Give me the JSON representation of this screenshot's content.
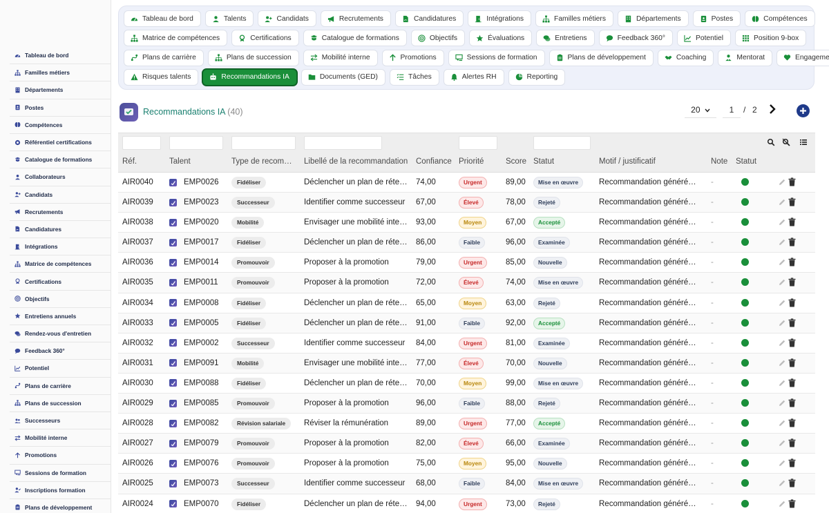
{
  "sidebar": {
    "items": [
      {
        "label": "Tableau de bord",
        "icon": "dashboard-icon"
      },
      {
        "label": "Familles métiers",
        "icon": "sitemap-icon"
      },
      {
        "label": "Départements",
        "icon": "building-icon"
      },
      {
        "label": "Postes",
        "icon": "badge-icon"
      },
      {
        "label": "Compétences",
        "icon": "brain-icon"
      },
      {
        "label": "Référentiel certifications",
        "icon": "certificate-icon"
      },
      {
        "label": "Catalogue de formations",
        "icon": "catalog-icon"
      },
      {
        "label": "Collaborateurs",
        "icon": "user-icon"
      },
      {
        "label": "Candidats",
        "icon": "user-plus-icon"
      },
      {
        "label": "Recrutements",
        "icon": "megaphone-icon"
      },
      {
        "label": "Candidatures",
        "icon": "file-signature-icon"
      },
      {
        "label": "Intégrations",
        "icon": "door-icon"
      },
      {
        "label": "Matrice de compétences",
        "icon": "sitemap-icon"
      },
      {
        "label": "Certifications",
        "icon": "award-icon"
      },
      {
        "label": "Objectifs",
        "icon": "target-icon"
      },
      {
        "label": "Entretiens annuels",
        "icon": "star-icon"
      },
      {
        "label": "Rendez-vous d'entretien",
        "icon": "comments-icon"
      },
      {
        "label": "Feedback 360°",
        "icon": "comment-icon"
      },
      {
        "label": "Potentiel",
        "icon": "chart-line-icon"
      },
      {
        "label": "Plans de carrière",
        "icon": "route-icon"
      },
      {
        "label": "Plans de succession",
        "icon": "sitemap-icon"
      },
      {
        "label": "Successeurs",
        "icon": "users-icon"
      },
      {
        "label": "Mobilité interne",
        "icon": "exchange-icon"
      },
      {
        "label": "Promotions",
        "icon": "arrow-up-icon"
      },
      {
        "label": "Sessions de formation",
        "icon": "chalkboard-icon"
      },
      {
        "label": "Inscriptions formation",
        "icon": "user-check-icon"
      },
      {
        "label": "Plans de développement",
        "icon": "clipboard-icon"
      }
    ]
  },
  "tabs": {
    "rows": [
      [
        {
          "label": "Tableau de bord",
          "icon": "dashboard-icon"
        },
        {
          "label": "Talents",
          "icon": "user-icon"
        },
        {
          "label": "Candidats",
          "icon": "user-plus-icon"
        },
        {
          "label": "Recrutements",
          "icon": "megaphone-icon"
        },
        {
          "label": "Candidatures",
          "icon": "file-signature-icon"
        },
        {
          "label": "Intégrations",
          "icon": "door-icon"
        },
        {
          "label": "Familles métiers",
          "icon": "sitemap-icon"
        },
        {
          "label": "Départements",
          "icon": "building-icon"
        },
        {
          "label": "Postes",
          "icon": "badge-icon"
        },
        {
          "label": "Compétences",
          "icon": "brain-icon"
        }
      ],
      [
        {
          "label": "Matrice de compétences",
          "icon": "sitemap-icon"
        },
        {
          "label": "Certifications",
          "icon": "award-icon"
        },
        {
          "label": "Catalogue de formations",
          "icon": "catalog-icon"
        },
        {
          "label": "Objectifs",
          "icon": "target-icon"
        },
        {
          "label": "Évaluations",
          "icon": "star-icon"
        },
        {
          "label": "Entretiens",
          "icon": "comments-icon"
        },
        {
          "label": "Feedback 360°",
          "icon": "comment-icon"
        },
        {
          "label": "Potentiel",
          "icon": "chart-line-icon"
        },
        {
          "label": "Position 9-box",
          "icon": "grid-icon"
        }
      ],
      [
        {
          "label": "Plans de carrière",
          "icon": "route-icon"
        },
        {
          "label": "Plans de succession",
          "icon": "sitemap-icon"
        },
        {
          "label": "Mobilité interne",
          "icon": "exchange-icon"
        },
        {
          "label": "Promotions",
          "icon": "arrow-up-icon"
        },
        {
          "label": "Sessions de formation",
          "icon": "chalkboard-icon"
        },
        {
          "label": "Plans de développement",
          "icon": "clipboard-icon"
        },
        {
          "label": "Coaching",
          "icon": "handshake-icon"
        },
        {
          "label": "Mentorat",
          "icon": "user-tie-icon"
        },
        {
          "label": "Engagement",
          "icon": "heart-icon"
        }
      ],
      [
        {
          "label": "Risques talents",
          "icon": "warning-icon"
        },
        {
          "label": "Recommandations IA",
          "icon": "robot-icon",
          "active": true
        },
        {
          "label": "Documents (GED)",
          "icon": "folder-icon"
        },
        {
          "label": "Tâches",
          "icon": "tasks-icon"
        },
        {
          "label": "Alertes RH",
          "icon": "bell-icon"
        },
        {
          "label": "Reporting",
          "icon": "pie-chart-icon"
        }
      ]
    ]
  },
  "header": {
    "title": "Recommandations IA",
    "count": "(40)"
  },
  "pager": {
    "page_size": "20",
    "current_page": "1",
    "separator": "/",
    "total_pages": "2"
  },
  "table": {
    "columns": {
      "ref": "Réf.",
      "talent": "Talent",
      "type": "Type de recom…",
      "label": "Libellé de la recommandation",
      "confidence": "Confiance",
      "priority": "Priorité",
      "score": "Score",
      "status": "Statut",
      "motif": "Motif / justificatif",
      "note": "Note",
      "status2": "Statut"
    },
    "rows": [
      {
        "ref": "AIR0040",
        "talent": "EMP0026",
        "type": "Fidéliser",
        "label": "Déclencher un plan de réten…",
        "confidence": "74,00",
        "priority": "Urgent",
        "score": "89,00",
        "status": "Mise en œuvre",
        "motif": "Recommandation générée …",
        "note": "-"
      },
      {
        "ref": "AIR0039",
        "talent": "EMP0023",
        "type": "Successeur",
        "label": "Identifier comme successeur",
        "confidence": "67,00",
        "priority": "Élevé",
        "score": "78,00",
        "status": "Rejeté",
        "motif": "Recommandation générée …",
        "note": "-"
      },
      {
        "ref": "AIR0038",
        "talent": "EMP0020",
        "type": "Mobilité",
        "label": "Envisager une mobilité interne",
        "confidence": "93,00",
        "priority": "Moyen",
        "score": "67,00",
        "status": "Accepté",
        "motif": "Recommandation générée …",
        "note": "-"
      },
      {
        "ref": "AIR0037",
        "talent": "EMP0017",
        "type": "Fidéliser",
        "label": "Déclencher un plan de réten…",
        "confidence": "86,00",
        "priority": "Faible",
        "score": "96,00",
        "status": "Examinée",
        "motif": "Recommandation générée …",
        "note": "-"
      },
      {
        "ref": "AIR0036",
        "talent": "EMP0014",
        "type": "Promouvoir",
        "label": "Proposer à la promotion",
        "confidence": "79,00",
        "priority": "Urgent",
        "score": "85,00",
        "status": "Nouvelle",
        "motif": "Recommandation générée …",
        "note": "-"
      },
      {
        "ref": "AIR0035",
        "talent": "EMP0011",
        "type": "Promouvoir",
        "label": "Proposer à la promotion",
        "confidence": "72,00",
        "priority": "Élevé",
        "score": "74,00",
        "status": "Mise en œuvre",
        "motif": "Recommandation générée …",
        "note": "-"
      },
      {
        "ref": "AIR0034",
        "talent": "EMP0008",
        "type": "Fidéliser",
        "label": "Déclencher un plan de réten…",
        "confidence": "65,00",
        "priority": "Moyen",
        "score": "63,00",
        "status": "Rejeté",
        "motif": "Recommandation générée …",
        "note": "-"
      },
      {
        "ref": "AIR0033",
        "talent": "EMP0005",
        "type": "Fidéliser",
        "label": "Déclencher un plan de réten…",
        "confidence": "91,00",
        "priority": "Faible",
        "score": "92,00",
        "status": "Accepté",
        "motif": "Recommandation générée …",
        "note": "-"
      },
      {
        "ref": "AIR0032",
        "talent": "EMP0002",
        "type": "Successeur",
        "label": "Identifier comme successeur",
        "confidence": "84,00",
        "priority": "Urgent",
        "score": "81,00",
        "status": "Examinée",
        "motif": "Recommandation générée …",
        "note": "-"
      },
      {
        "ref": "AIR0031",
        "talent": "EMP0091",
        "type": "Mobilité",
        "label": "Envisager une mobilité interne",
        "confidence": "77,00",
        "priority": "Élevé",
        "score": "70,00",
        "status": "Nouvelle",
        "motif": "Recommandation générée …",
        "note": "-"
      },
      {
        "ref": "AIR0030",
        "talent": "EMP0088",
        "type": "Fidéliser",
        "label": "Déclencher un plan de réten…",
        "confidence": "70,00",
        "priority": "Moyen",
        "score": "99,00",
        "status": "Mise en œuvre",
        "motif": "Recommandation générée …",
        "note": "-"
      },
      {
        "ref": "AIR0029",
        "talent": "EMP0085",
        "type": "Promouvoir",
        "label": "Proposer à la promotion",
        "confidence": "96,00",
        "priority": "Faible",
        "score": "88,00",
        "status": "Rejeté",
        "motif": "Recommandation générée …",
        "note": "-"
      },
      {
        "ref": "AIR0028",
        "talent": "EMP0082",
        "type": "Révision salariale",
        "label": "Réviser la rémunération",
        "confidence": "89,00",
        "priority": "Urgent",
        "score": "77,00",
        "status": "Accepté",
        "motif": "Recommandation générée …",
        "note": "-"
      },
      {
        "ref": "AIR0027",
        "talent": "EMP0079",
        "type": "Promouvoir",
        "label": "Proposer à la promotion",
        "confidence": "82,00",
        "priority": "Élevé",
        "score": "66,00",
        "status": "Examinée",
        "motif": "Recommandation générée …",
        "note": "-"
      },
      {
        "ref": "AIR0026",
        "talent": "EMP0076",
        "type": "Promouvoir",
        "label": "Proposer à la promotion",
        "confidence": "75,00",
        "priority": "Moyen",
        "score": "95,00",
        "status": "Nouvelle",
        "motif": "Recommandation générée …",
        "note": "-"
      },
      {
        "ref": "AIR0025",
        "talent": "EMP0073",
        "type": "Successeur",
        "label": "Identifier comme successeur",
        "confidence": "68,00",
        "priority": "Faible",
        "score": "84,00",
        "status": "Mise en œuvre",
        "motif": "Recommandation générée …",
        "note": "-"
      },
      {
        "ref": "AIR0024",
        "talent": "EMP0070",
        "type": "Fidéliser",
        "label": "Déclencher un plan de réten…",
        "confidence": "94,00",
        "priority": "Urgent",
        "score": "73,00",
        "status": "Rejeté",
        "motif": "Recommandation générée …",
        "note": "-"
      }
    ]
  },
  "colors": {
    "accent_green": "#1a8f3a",
    "title_teal": "#1a8070",
    "sidebar_text": "#1e2a48",
    "add_button": "#1f3a8a",
    "priority": {
      "Urgent": {
        "bg": "#fde8e8",
        "fg": "#c62828",
        "border": "#f3b0b0"
      },
      "Élevé": {
        "bg": "#fde8e8",
        "fg": "#c62828",
        "border": "#f3b0b0"
      },
      "Moyen": {
        "bg": "#fff4dc",
        "fg": "#b8860b",
        "border": "#f0d48a"
      },
      "Faible": {
        "bg": "#eef0f4",
        "fg": "#2f3e5a",
        "border": "#e0e3ea"
      }
    },
    "status": {
      "Mise en œuvre": {
        "bg": "#eef0f4",
        "fg": "#2f3e5a",
        "border": "#e0e3ea"
      },
      "Rejeté": {
        "bg": "#eef0f4",
        "fg": "#2f3e5a",
        "border": "#e0e3ea"
      },
      "Accepté": {
        "bg": "#e6f5e9",
        "fg": "#1a8f3a",
        "border": "#b6e0c0"
      },
      "Examinée": {
        "bg": "#eef0f4",
        "fg": "#2f3e5a",
        "border": "#e0e3ea"
      },
      "Nouvelle": {
        "bg": "#eef0f4",
        "fg": "#2f3e5a",
        "border": "#e0e3ea"
      }
    }
  }
}
